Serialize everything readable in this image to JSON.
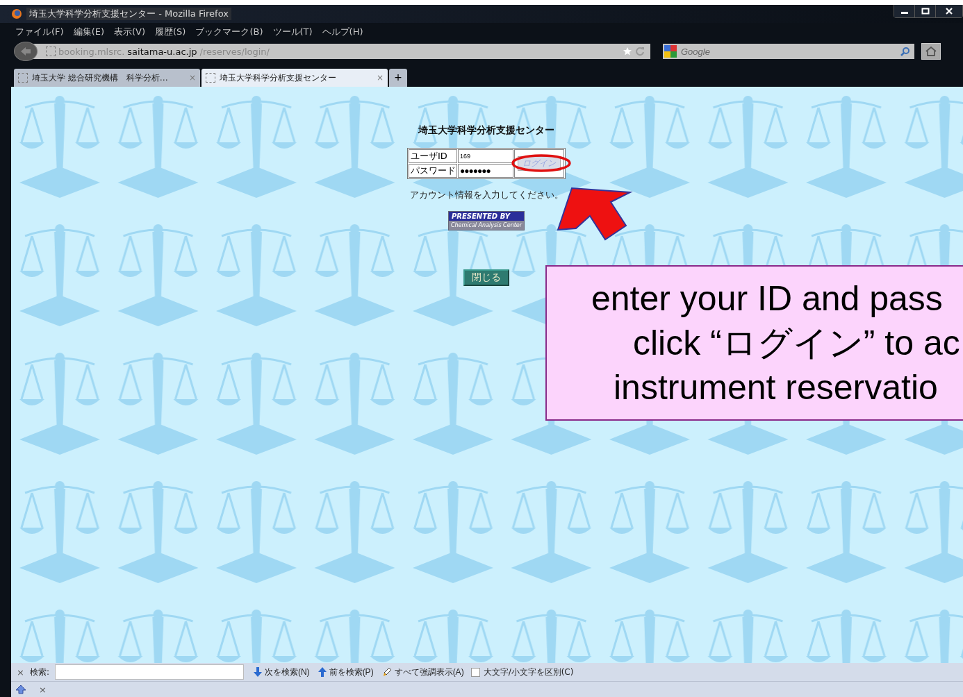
{
  "window": {
    "title": "埼玉大学科学分析支援センター - Mozilla Firefox"
  },
  "menu": [
    "ファイル(F)",
    "編集(E)",
    "表示(V)",
    "履歴(S)",
    "ブックマーク(B)",
    "ツール(T)",
    "ヘルプ(H)"
  ],
  "address_bar": {
    "parts": [
      {
        "text": "booking.mlsrc.",
        "emphasis": false
      },
      {
        "text": "saitama-u.ac.jp",
        "emphasis": true
      },
      {
        "text": "/reserves/login/",
        "emphasis": false
      }
    ]
  },
  "search_bar": {
    "placeholder": "Google"
  },
  "tabs": [
    {
      "label": "埼玉大学 総合研究機構　科学分析…",
      "selected": false,
      "close": "×"
    },
    {
      "label": "埼玉大学科学分析支援センター",
      "selected": true,
      "close": "×"
    }
  ],
  "new_tab": "+",
  "page": {
    "heading": "埼玉大学科学分析支援センター",
    "fields": [
      {
        "label": "ユーザID",
        "value": "169"
      },
      {
        "label": "パスワード",
        "value": "●●●●●●●"
      }
    ],
    "login_button": {
      "label": "ログイン",
      "disabled": true
    },
    "message": "アカウント情報を入力してください。",
    "banner": [
      "PRESENTED BY",
      "Chemical Analysis Center"
    ],
    "close_button": "閉じる"
  },
  "annotation": {
    "lines": [
      "enter your ID and pass",
      "click “ログイン” to ac",
      "instrument reservatio"
    ]
  },
  "find_bar": {
    "close": "×",
    "label": "検索:",
    "buttons": [
      {
        "label": "次を検索(N)",
        "kind": "down"
      },
      {
        "label": "前を検索(P)",
        "kind": "up"
      },
      {
        "label": "すべて強調表示(A)",
        "kind": "highlight"
      }
    ],
    "checkbox": {
      "label": "大文字/小文字を区別(C)",
      "checked": false
    }
  },
  "status_bar": {
    "close": "×"
  }
}
